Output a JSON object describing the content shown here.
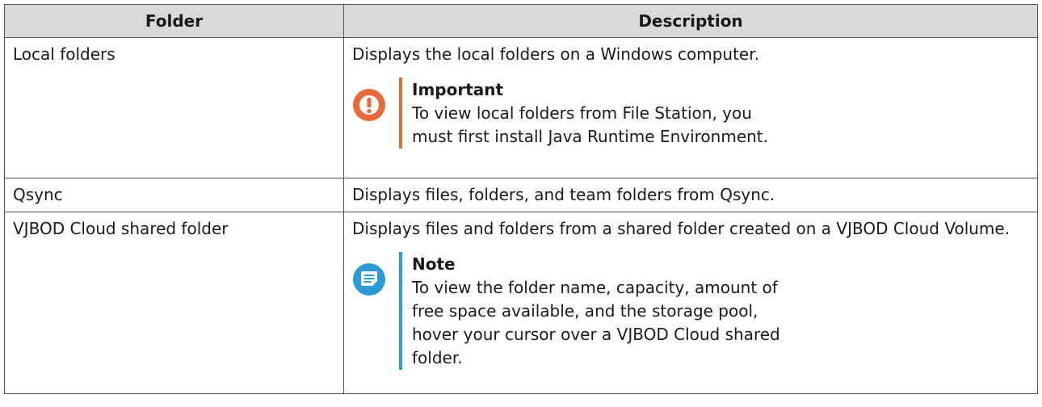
{
  "table": {
    "headers": {
      "folder": "Folder",
      "description": "Description"
    },
    "rows": [
      {
        "folder": "Local folders",
        "description": "Displays the local folders on a Windows computer.",
        "callout": {
          "kind": "important",
          "icon": "exclamation-icon",
          "color": "#e8693e",
          "title": "Important",
          "text": "To view local folders from File Station, you must first install Java Runtime Environment."
        }
      },
      {
        "folder": "Qsync",
        "description": "Displays files, folders, and team folders from Qsync."
      },
      {
        "folder": "VJBOD Cloud shared folder",
        "description": "Displays files and folders from a shared folder created on a VJBOD Cloud Volume.",
        "callout": {
          "kind": "note",
          "icon": "note-icon",
          "color": "#2a9bd6",
          "title": "Note",
          "text": "To view the folder name, capacity, amount of free space available, and the storage pool, hover your cursor over a VJBOD Cloud shared folder."
        }
      }
    ]
  }
}
